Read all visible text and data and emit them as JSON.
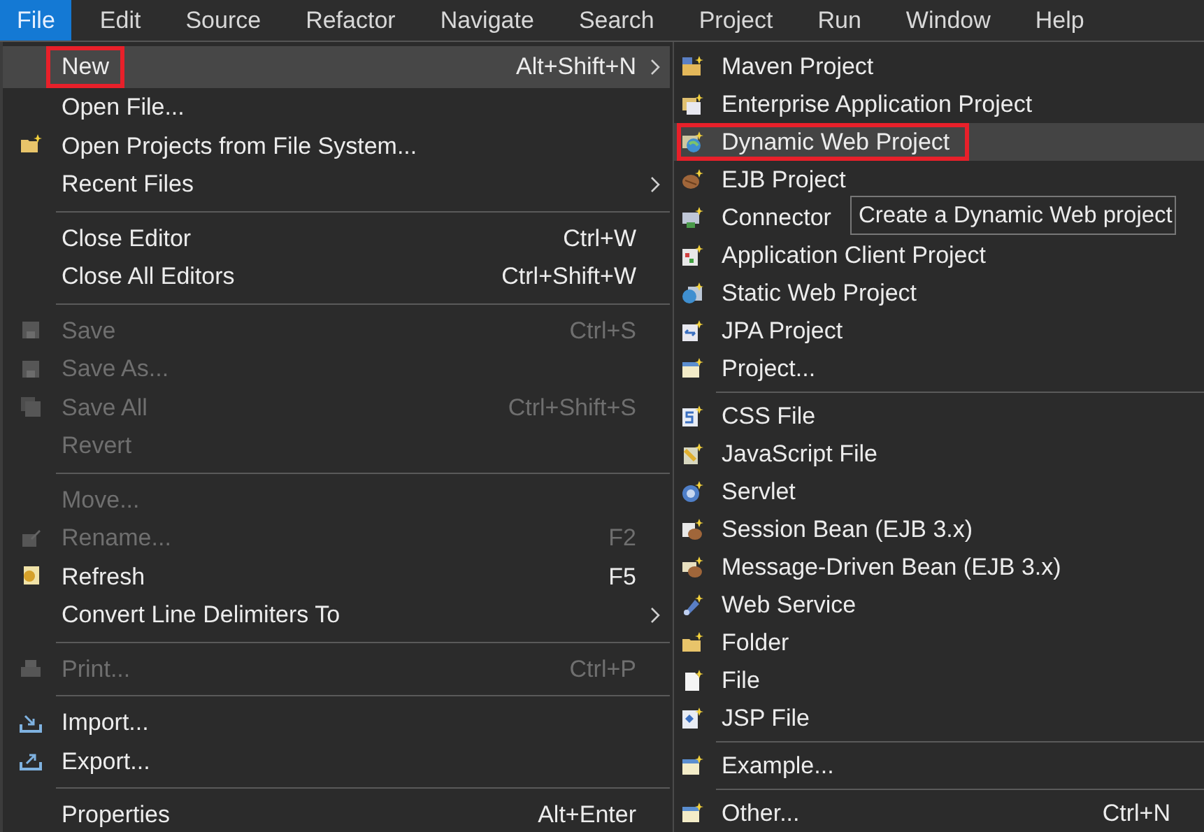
{
  "menubar": [
    {
      "label": "File",
      "selected": true
    },
    {
      "label": "Edit",
      "selected": false
    },
    {
      "label": "Source",
      "selected": false
    },
    {
      "label": "Refactor",
      "selected": false
    },
    {
      "label": "Navigate",
      "selected": false
    },
    {
      "label": "Search",
      "selected": false
    },
    {
      "label": "Project",
      "selected": false
    },
    {
      "label": "Run",
      "selected": false
    },
    {
      "label": "Window",
      "selected": false
    },
    {
      "label": "Help",
      "selected": false
    }
  ],
  "file_menu": [
    {
      "kind": "item",
      "label": "New",
      "shortcut": "Alt+Shift+N",
      "submenu": true,
      "disabled": false,
      "selected": true,
      "annotated": true
    },
    {
      "kind": "item",
      "label": "Open File...",
      "disabled": false,
      "submenu": false,
      "selected": false,
      "annotated": false
    },
    {
      "kind": "item",
      "label": "Open Projects from File System...",
      "disabled": false,
      "submenu": false,
      "selected": false,
      "annotated": false
    },
    {
      "kind": "item",
      "label": "Recent Files",
      "disabled": false,
      "submenu": true,
      "selected": false,
      "annotated": false
    },
    {
      "kind": "separator"
    },
    {
      "kind": "item",
      "label": "Close Editor",
      "shortcut": "Ctrl+W",
      "disabled": false,
      "submenu": false,
      "selected": false,
      "annotated": false
    },
    {
      "kind": "item",
      "label": "Close All Editors",
      "shortcut": "Ctrl+Shift+W",
      "disabled": false,
      "submenu": false,
      "selected": false,
      "annotated": false
    },
    {
      "kind": "separator"
    },
    {
      "kind": "item",
      "label": "Save",
      "shortcut": "Ctrl+S",
      "disabled": true,
      "submenu": false,
      "selected": false,
      "annotated": false
    },
    {
      "kind": "item",
      "label": "Save As...",
      "disabled": true,
      "submenu": false,
      "selected": false,
      "annotated": false
    },
    {
      "kind": "item",
      "label": "Save All",
      "shortcut": "Ctrl+Shift+S",
      "disabled": true,
      "submenu": false,
      "selected": false,
      "annotated": false
    },
    {
      "kind": "item",
      "label": "Revert",
      "disabled": true,
      "submenu": false,
      "selected": false,
      "annotated": false
    },
    {
      "kind": "separator"
    },
    {
      "kind": "item",
      "label": "Move...",
      "disabled": true,
      "submenu": false,
      "selected": false,
      "annotated": false
    },
    {
      "kind": "item",
      "label": "Rename...",
      "shortcut": "F2",
      "disabled": true,
      "submenu": false,
      "selected": false,
      "annotated": false
    },
    {
      "kind": "item",
      "label": "Refresh",
      "shortcut": "F5",
      "disabled": false,
      "submenu": false,
      "selected": false,
      "annotated": false
    },
    {
      "kind": "item",
      "label": "Convert Line Delimiters To",
      "disabled": false,
      "submenu": true,
      "selected": false,
      "annotated": false
    },
    {
      "kind": "separator"
    },
    {
      "kind": "item",
      "label": "Print...",
      "shortcut": "Ctrl+P",
      "disabled": true,
      "submenu": false,
      "selected": false,
      "annotated": false
    },
    {
      "kind": "separator"
    },
    {
      "kind": "item",
      "label": "Import...",
      "disabled": false,
      "submenu": false,
      "selected": false,
      "annotated": false
    },
    {
      "kind": "item",
      "label": "Export...",
      "disabled": false,
      "submenu": false,
      "selected": false,
      "annotated": false
    },
    {
      "kind": "separator"
    },
    {
      "kind": "item",
      "label": "Properties",
      "shortcut": "Alt+Enter",
      "disabled": false,
      "submenu": false,
      "selected": false,
      "annotated": false
    }
  ],
  "new_submenu": [
    {
      "kind": "item",
      "label": "Maven Project",
      "selected": false,
      "annotated": false
    },
    {
      "kind": "item",
      "label": "Enterprise Application Project",
      "selected": false,
      "annotated": false
    },
    {
      "kind": "item",
      "label": "Dynamic Web Project",
      "selected": true,
      "annotated": true
    },
    {
      "kind": "item",
      "label": "EJB Project",
      "selected": false,
      "annotated": false
    },
    {
      "kind": "item",
      "label": "Connector",
      "selected": false,
      "annotated": false
    },
    {
      "kind": "item",
      "label": "Application Client Project",
      "selected": false,
      "annotated": false
    },
    {
      "kind": "item",
      "label": "Static Web Project",
      "selected": false,
      "annotated": false
    },
    {
      "kind": "item",
      "label": "JPA Project",
      "selected": false,
      "annotated": false
    },
    {
      "kind": "item",
      "label": "Project...",
      "selected": false,
      "annotated": false
    },
    {
      "kind": "separator"
    },
    {
      "kind": "item",
      "label": "CSS File",
      "selected": false,
      "annotated": false
    },
    {
      "kind": "item",
      "label": "JavaScript File",
      "selected": false,
      "annotated": false
    },
    {
      "kind": "item",
      "label": "Servlet",
      "selected": false,
      "annotated": false
    },
    {
      "kind": "item",
      "label": "Session Bean (EJB 3.x)",
      "selected": false,
      "annotated": false
    },
    {
      "kind": "item",
      "label": "Message-Driven Bean (EJB 3.x)",
      "selected": false,
      "annotated": false
    },
    {
      "kind": "item",
      "label": "Web Service",
      "selected": false,
      "annotated": false
    },
    {
      "kind": "item",
      "label": "Folder",
      "selected": false,
      "annotated": false
    },
    {
      "kind": "item",
      "label": "File",
      "selected": false,
      "annotated": false
    },
    {
      "kind": "item",
      "label": "JSP File",
      "selected": false,
      "annotated": false
    },
    {
      "kind": "separator"
    },
    {
      "kind": "item",
      "label": "Example...",
      "selected": false,
      "annotated": false
    },
    {
      "kind": "separator"
    },
    {
      "kind": "item",
      "label": "Other...",
      "shortcut": "Ctrl+N",
      "selected": false,
      "annotated": false
    }
  ],
  "tooltip": {
    "text": "Create a Dynamic Web project"
  }
}
